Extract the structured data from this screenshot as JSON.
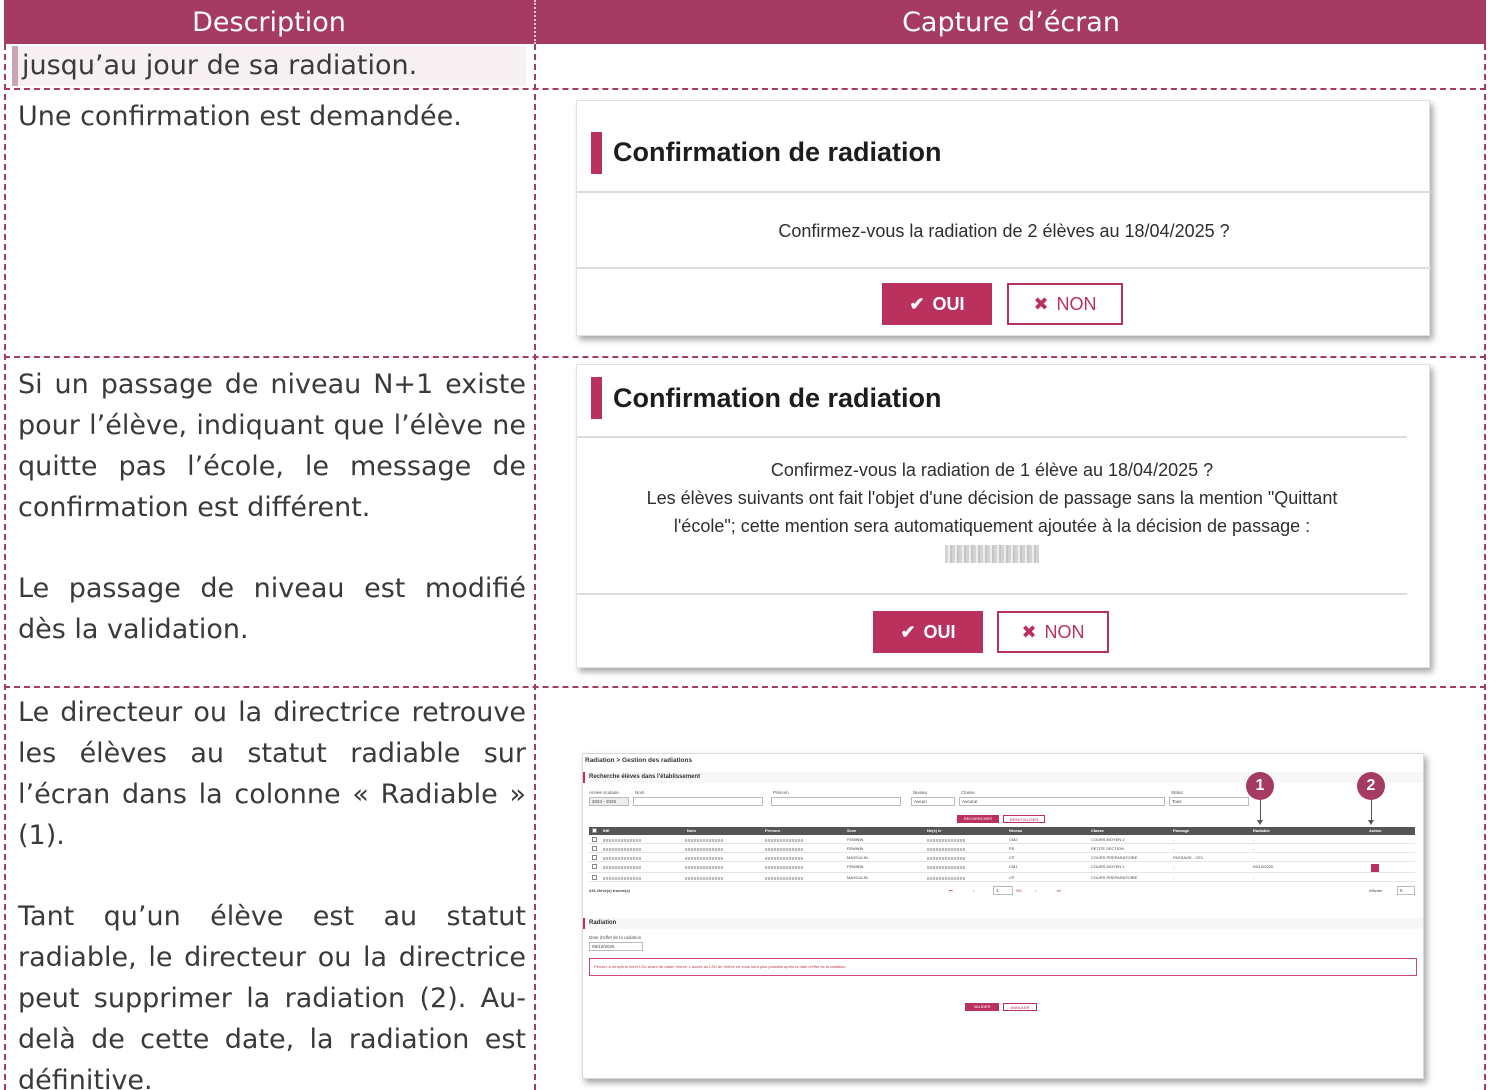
{
  "header": {
    "col_left": "Description",
    "col_right": "Capture d’écran"
  },
  "rows": {
    "prev_text": "jusqu’au jour de sa radiation.",
    "row1_text": "Une confirmation est demandée.",
    "row2_para1": "Si un passage de niveau N+1 existe pour l’élève, indiquant que l’élève ne quitte pas l’école, le message de confirmation est différent.",
    "row2_para2": "Le passage de niveau est modifié dès la validation.",
    "row3_para1": "Le directeur ou la directrice retrouve les élèves au statut radiable sur l’écran dans la colonne « Radiable » (1).",
    "row3_para2": "Tant qu’un élève est au statut radiable, le directeur ou la directrice peut supprimer la radiation (2). Au-delà de cette date, la radiation est définitive."
  },
  "dialog1": {
    "title": "Confirmation de radiation",
    "message": "Confirmez-vous la radiation de 2 élèves au 18/04/2025 ?",
    "oui_label": "OUI",
    "non_label": "NON"
  },
  "dialog2": {
    "title": "Confirmation de radiation",
    "line1": "Confirmez-vous la radiation de 1 élève au 18/04/2025 ?",
    "line2": "Les élèves suivants ont fait l'objet d'une décision de passage sans la mention \"Quittant",
    "line3": "l'école\"; cette mention sera automatiquement ajoutée à la décision de passage :",
    "oui_label": "OUI",
    "non_label": "NON"
  },
  "mini_ui": {
    "breadcrumb": "Radiation > Gestion des radiations",
    "search_title": "Recherche élèves dans l'établissement",
    "labels": {
      "annee": "Année scolaire",
      "nom": "Nom",
      "prenom": "Prénom",
      "niveau": "Niveau",
      "classe": "Classe",
      "statut": "Statut"
    },
    "values": {
      "annee": "2024 - 2025",
      "niveau": "Aucun",
      "classe": "Aucune",
      "statut": "Tous"
    },
    "btn_rechercher": "RECHERCHER",
    "btn_reinitialiser": "RÉINITIALISER",
    "columns": [
      "INE",
      "Nom",
      "Prénom",
      "Sexe",
      "Né(e) le",
      "Niveau",
      "Classe",
      "Passage",
      "Radiable",
      "Action"
    ],
    "table_rows": [
      {
        "sexe": "FEMININ",
        "niveau": "CM2",
        "classe": "COURS MOYEN 2",
        "passage": "-",
        "radiable": "-"
      },
      {
        "sexe": "FEMININ",
        "niveau": "PS",
        "classe": "PETITE SECTION",
        "passage": "-",
        "radiable": "-"
      },
      {
        "sexe": "MASCULIN",
        "niveau": "CP",
        "classe": "COURS PREPARATOIRE",
        "passage": "PASSAGE - CE1",
        "radiable": "-"
      },
      {
        "sexe": "FEMININ",
        "niveau": "CM1",
        "classe": "COURS MOYEN 1",
        "passage": "-",
        "radiable": "09/10/2025"
      },
      {
        "sexe": "MASCULIN",
        "niveau": "CP",
        "classe": "COURS PREPARATOIRE",
        "passage": "-",
        "radiable": "-"
      }
    ],
    "found": "246 élève(s) trouvé(s)",
    "pagination": "1",
    "page_total": "/50",
    "afficher": "Afficher",
    "afficher_val": "5",
    "radiation_title": "Radiation",
    "date_label": "Date d'effet de la radiation",
    "date_value": "09/10/2025",
    "warning": "Pensez à remplir le livret LSU avant de radier l'élève. L'accès au LSU de l'élève ne vous sera plus possible après la date d'effet de la radiation.",
    "btn_valider": "VALIDER",
    "btn_annuler": "ANNULER",
    "callout1": "1",
    "callout2": "2"
  },
  "colors": {
    "accent": "#a53a62",
    "button": "#b9315c"
  }
}
